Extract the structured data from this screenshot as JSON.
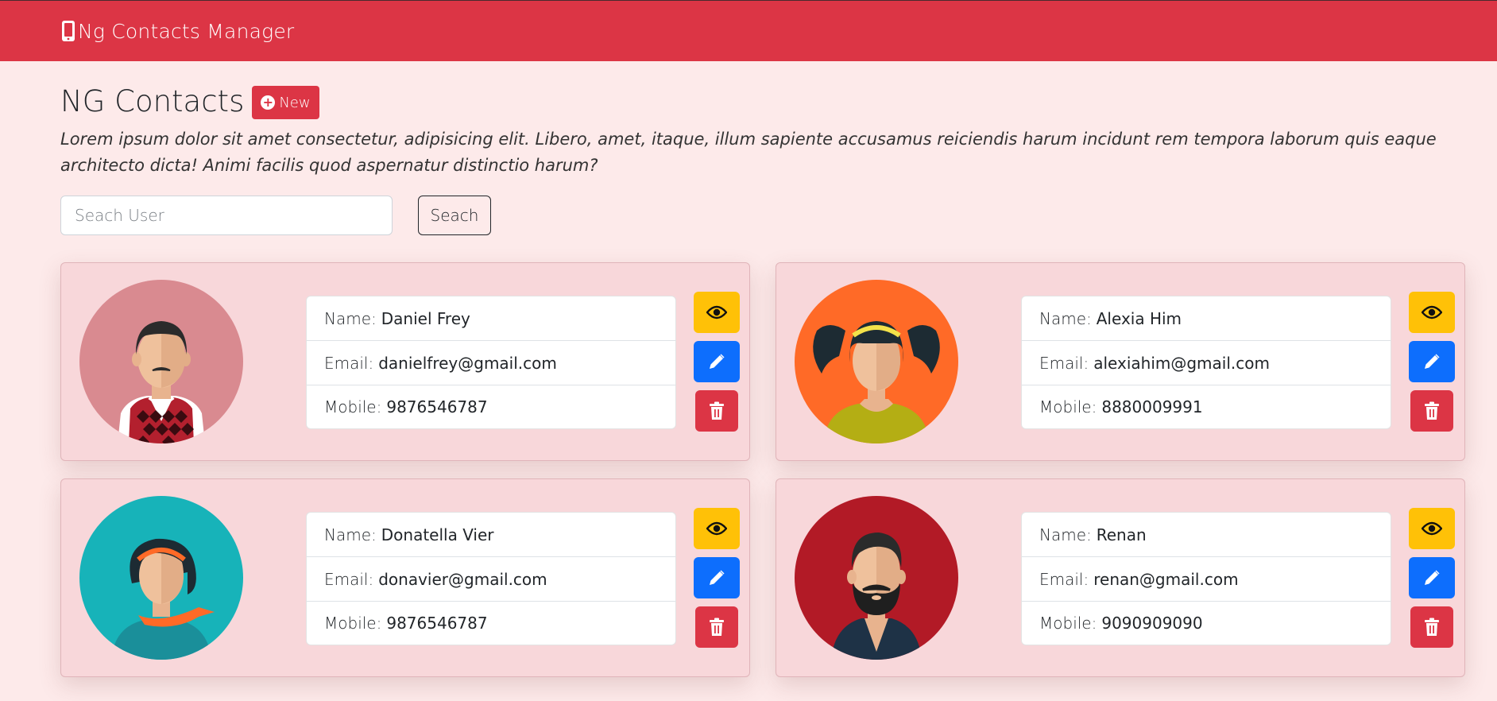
{
  "navbar": {
    "brand": "Ng Contacts Manager",
    "brand_icon": "mobile-phone-icon"
  },
  "header": {
    "title": "NG Contacts",
    "new_label": "New",
    "new_icon": "plus-circle-icon"
  },
  "description": "Lorem ipsum dolor sit amet consectetur, adipisicing elit. Libero, amet, itaque, illum sapiente accusamus reiciendis harum incidunt rem tempora laborum quis eaque architecto dicta! Animi facilis quod aspernatur distinctio harum?",
  "search": {
    "placeholder": "Seach User",
    "value": "",
    "button_label": "Seach"
  },
  "labels": {
    "name": "Name:",
    "email": "Email:",
    "mobile": "Mobile:"
  },
  "contacts": [
    {
      "name": "Daniel Frey",
      "email": "danielfrey@gmail.com",
      "mobile": "9876546787",
      "avatar_bg": "#d98a90"
    },
    {
      "name": "Alexia Him",
      "email": "alexiahim@gmail.com",
      "mobile": "8880009991",
      "avatar_bg": "#ff6a27"
    },
    {
      "name": "Donatella Vier",
      "email": "donavier@gmail.com",
      "mobile": "9876546787",
      "avatar_bg": "#17b3b9"
    },
    {
      "name": "Renan",
      "email": "renan@gmail.com",
      "mobile": "9090909090",
      "avatar_bg": "#b21a26"
    }
  ],
  "actions": {
    "view_icon": "eye-icon",
    "edit_icon": "pencil-icon",
    "delete_icon": "trash-icon"
  },
  "colors": {
    "primary_red": "#dc3545",
    "page_bg": "#fdeaea",
    "card_bg": "#f8d7da",
    "warning": "#ffc107",
    "primary_blue": "#0d6efd"
  }
}
